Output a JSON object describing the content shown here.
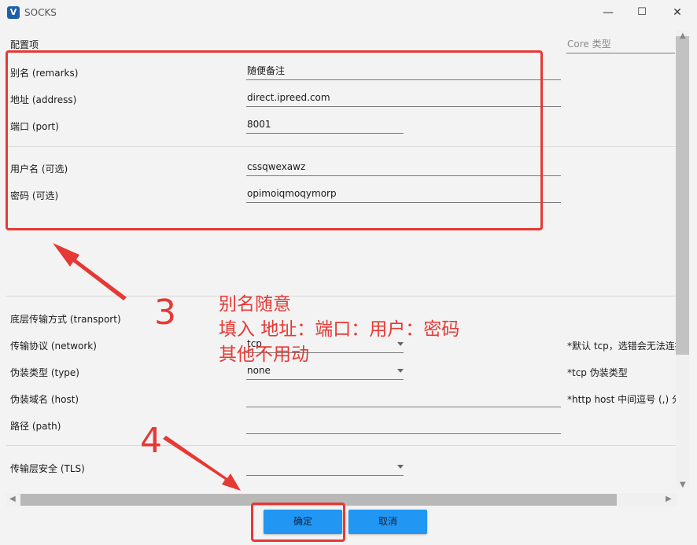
{
  "window": {
    "title": "SOCKS",
    "icon_label": "V",
    "controls": {
      "minimize": "—",
      "maximize": "☐",
      "close": "✕"
    }
  },
  "core_type": {
    "placeholder": "Core 类型"
  },
  "section_config": "配置项",
  "fields": {
    "remarks": {
      "label": "别名 (remarks)",
      "value": "随便备注"
    },
    "address": {
      "label": "地址 (address)",
      "value": "direct.ipreed.com"
    },
    "port": {
      "label": "端口 (port)",
      "value": "8001"
    },
    "username": {
      "label": "用户名 (可选)",
      "value": "cssqwexawz"
    },
    "password": {
      "label": "密码 (可选)",
      "value": "opimoiqmoqymorp"
    }
  },
  "transport": {
    "section_label": "底层传输方式 (transport)",
    "network": {
      "label": "传输协议 (network)",
      "value": "tcp",
      "note": "*默认 tcp，选错会无法连接"
    },
    "type": {
      "label": "伪装类型 (type)",
      "value": "none",
      "note": "*tcp 伪装类型"
    },
    "host": {
      "label": "伪装域名 (host)",
      "value": "",
      "note": "*http host 中间逗号 (,) 分隔"
    },
    "path": {
      "label": "路径 (path)",
      "value": ""
    }
  },
  "tls": {
    "label": "传输层安全 (TLS)",
    "value": ""
  },
  "buttons": {
    "ok": "确定",
    "cancel": "取消"
  },
  "annotations": {
    "step3_number": "3",
    "step3_lines": [
      "别名随意",
      "填入 地址：端口：用户：密码",
      "其他不用动"
    ],
    "step4_number": "4",
    "color": "#e53935"
  },
  "colors": {
    "accent": "#2196f3",
    "annotation_red": "#e53935"
  }
}
